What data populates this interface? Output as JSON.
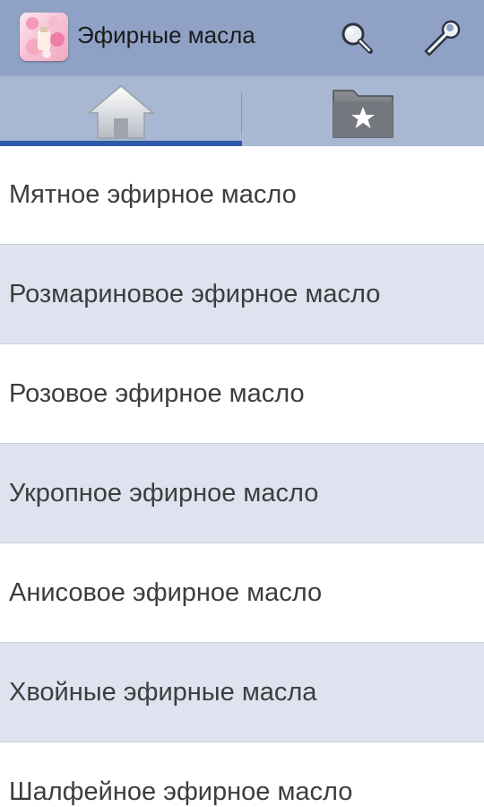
{
  "actionbar": {
    "title": "Эфирные масла",
    "app_icon": "app-logo-flowers-icon",
    "search_icon": "search-icon",
    "settings_icon": "wrench-icon",
    "background_color": "#8fa2c5"
  },
  "tabs": [
    {
      "icon": "home-icon",
      "selected": true
    },
    {
      "icon": "folder-star-icon",
      "selected": false
    }
  ],
  "accent_color": "#2f5aa8",
  "list": {
    "items": [
      "Мятное эфирное масло",
      "Розмариновое эфирное масло",
      "Розовое эфирное масло",
      "Укропное эфирное масло",
      "Анисовое эфирное масло",
      "Хвойные эфирные масла",
      "Шалфейное эфирное масло"
    ]
  }
}
